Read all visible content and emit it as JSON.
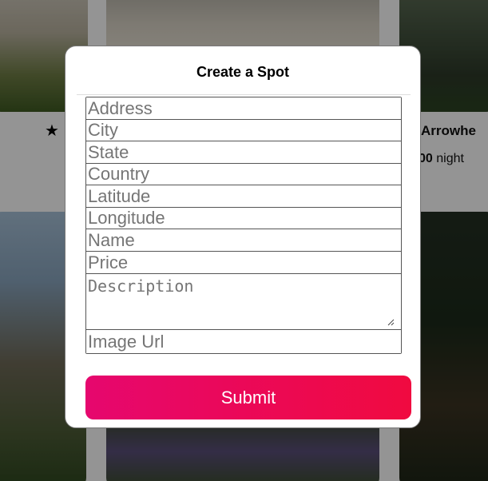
{
  "background": {
    "listing_title": "ke Arrowhe",
    "listing_price_value": "00",
    "listing_price_unit": "night",
    "star_glyph": "★"
  },
  "modal": {
    "title": "Create a Spot",
    "fields": {
      "address": "Address",
      "city": "City",
      "state": "State",
      "country": "Country",
      "latitude": "Latitude",
      "longitude": "Longitude",
      "name": "Name",
      "price": "Price",
      "description": "Description",
      "image_url": "Image Url"
    },
    "submit_label": "Submit"
  },
  "colors": {
    "submit_gradient_start": "#e6076e",
    "submit_gradient_end": "#f00a40",
    "overlay": "rgba(0,0,0,0.42)"
  }
}
